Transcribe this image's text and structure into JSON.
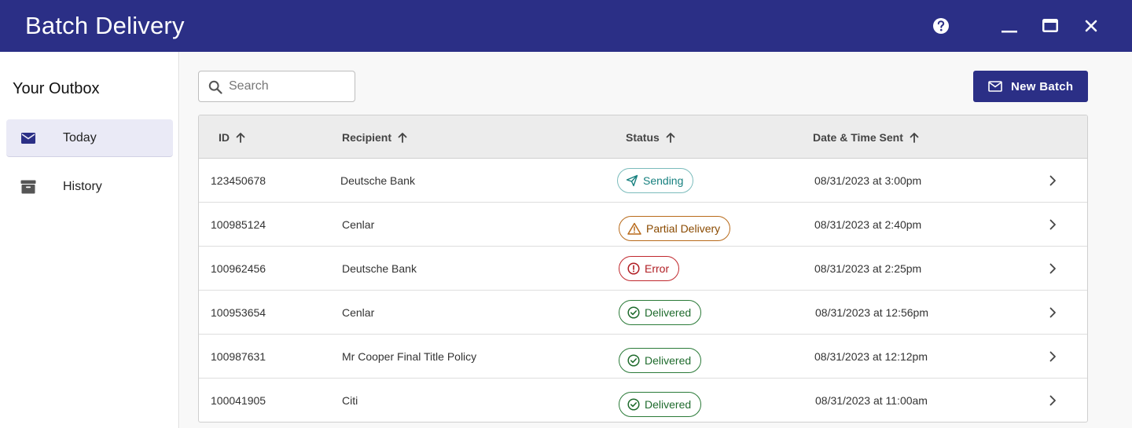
{
  "app": {
    "title": "Batch Delivery"
  },
  "titlebar": {
    "icons": [
      "help-icon",
      "minimize-icon",
      "maximize-icon",
      "close-icon"
    ]
  },
  "sidebar": {
    "heading": "Your Outbox",
    "items": [
      {
        "label": "Today",
        "icon": "envelope-icon",
        "active": true
      },
      {
        "label": "History",
        "icon": "archive-box-icon",
        "active": false
      }
    ]
  },
  "toolbar": {
    "search_placeholder": "Search",
    "search_value": "",
    "new_batch_label": "New Batch"
  },
  "table": {
    "columns": [
      "ID",
      "Recipient",
      "Status",
      "Date & Time Sent"
    ],
    "rows": [
      {
        "id": "123450678",
        "recipient": "Deutsche Bank",
        "status": "Sending",
        "sent": "08/31/2023 at 3:00pm"
      },
      {
        "id": "100985124",
        "recipient": "Cenlar",
        "status": "Partial Delivery",
        "sent": "08/31/2023 at 2:40pm"
      },
      {
        "id": "100962456",
        "recipient": "Deutsche Bank",
        "status": "Error",
        "sent": "08/31/2023 at 2:25pm"
      },
      {
        "id": "100953654",
        "recipient": "Cenlar",
        "status": "Delivered",
        "sent": "08/31/2023 at 12:56pm"
      },
      {
        "id": "100987631",
        "recipient": "Mr Cooper Final Title Policy",
        "status": "Delivered",
        "sent": "08/31/2023 at 12:12pm"
      },
      {
        "id": "100041905",
        "recipient": "Citi",
        "status": "Delivered",
        "sent": "08/31/2023 at 11:00am"
      }
    ]
  },
  "colors": {
    "brand": "#2b2f86",
    "sending": "#17807f",
    "partial": "#8a4a00",
    "error": "#b01d23",
    "delivered": "#1f6b2d"
  }
}
